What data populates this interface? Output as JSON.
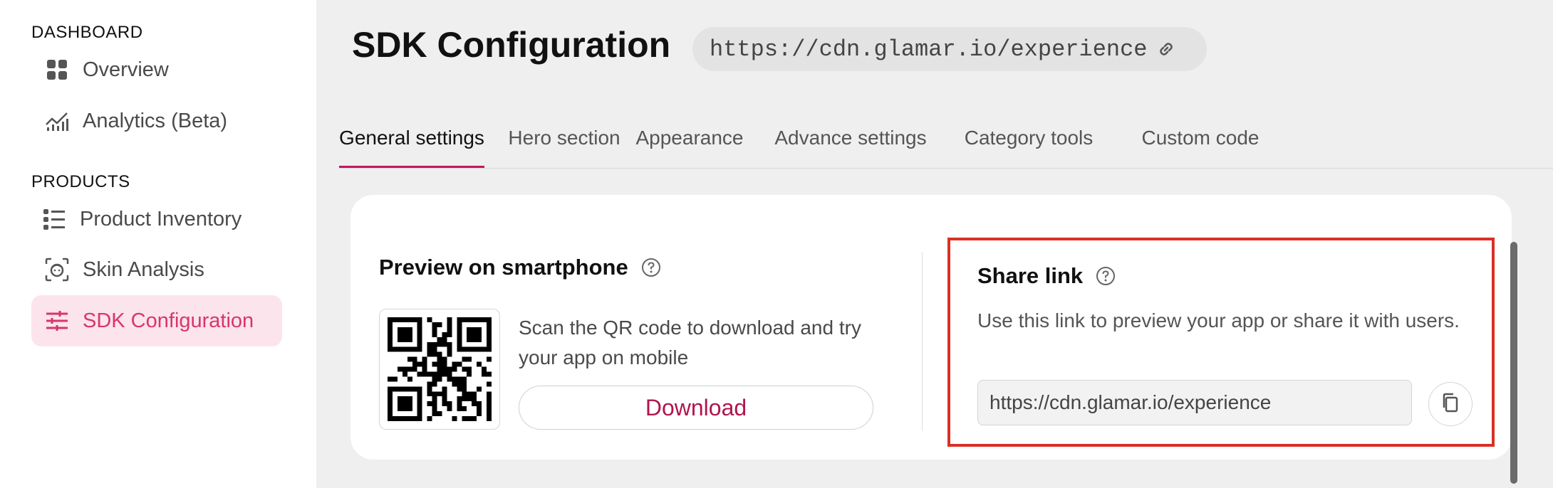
{
  "sidebar": {
    "dashboard_heading": "DASHBOARD",
    "products_heading": "PRODUCTS",
    "items": [
      {
        "label": "Overview",
        "icon": "grid-icon"
      },
      {
        "label": "Analytics (Beta)",
        "icon": "analytics-chart-icon"
      },
      {
        "label": "Product Inventory",
        "icon": "list-icon"
      },
      {
        "label": "Skin Analysis",
        "icon": "face-scan-icon"
      },
      {
        "label": "SDK Configuration",
        "icon": "sliders-icon",
        "active": true
      }
    ]
  },
  "header": {
    "title": "SDK Configuration",
    "url": "https://cdn.glamar.io/experience"
  },
  "tabs": [
    {
      "label": "General settings",
      "active": true
    },
    {
      "label": "Hero section"
    },
    {
      "label": "Appearance"
    },
    {
      "label": "Advance settings"
    },
    {
      "label": "Category tools"
    },
    {
      "label": "Custom code"
    }
  ],
  "preview": {
    "title": "Preview on smartphone",
    "description": "Scan the QR code to download and try your app on mobile",
    "download_label": "Download"
  },
  "share": {
    "title": "Share link",
    "description": "Use this link to preview your app or share it with users.",
    "link_value": "https://cdn.glamar.io/experience"
  },
  "colors": {
    "accent": "#c2185b",
    "active_nav_bg": "#fce4ec",
    "active_nav_text": "#d8356e",
    "highlight_border": "#d93025"
  }
}
